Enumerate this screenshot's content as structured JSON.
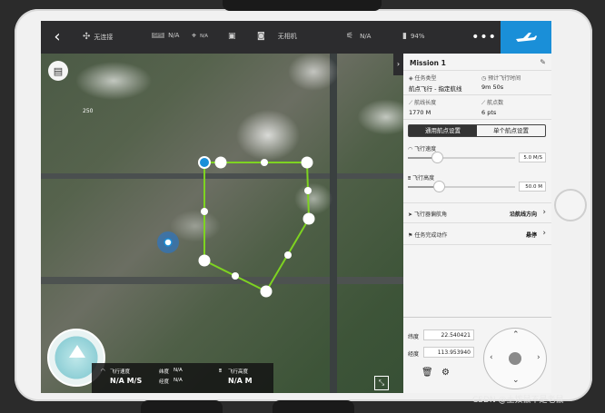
{
  "topbar": {
    "connection": "无连接",
    "gps": "N/A",
    "signal": "N/A",
    "camera": "无相机",
    "mode_value": "N/A",
    "battery": "94%",
    "more_label": "•••"
  },
  "map": {
    "scale_label": "250"
  },
  "panel": {
    "title": "Mission 1",
    "task_type_label": "任务类型",
    "task_type_value": "航点飞行 - 指定航线",
    "est_time_label": "预计飞行时间",
    "est_time_value": "9m 50s",
    "route_length_label": "航线长度",
    "route_length_value": "1770 M",
    "waypoint_count_label": "航点数",
    "waypoint_count_value": "6 pts",
    "tab_general": "通用航点设置",
    "tab_single": "单个航点设置",
    "speed_label": "飞行速度",
    "speed_value": "5.0 M/S",
    "speed_fraction": 0.27,
    "altitude_label": "飞行高度",
    "altitude_value": "50.0 M",
    "altitude_fraction": 0.29,
    "heading_label": "飞行器偏航角",
    "heading_value": "沿航线方向",
    "finish_label": "任务完成动作",
    "finish_value": "悬停",
    "lat_label": "纬度",
    "lat_value": "22.540421",
    "lng_label": "经度",
    "lng_value": "113.953940"
  },
  "telemetry": {
    "speed_label": "飞行速度",
    "speed_value": "N/A M/S",
    "lat_label": "纬度",
    "lat_value": "N/A",
    "lng_label": "经度",
    "lng_value": "N/A",
    "alt_label": "飞行高度",
    "alt_value": "N/A M"
  },
  "watermark": "CSDN @土拨鼠不是老鼠",
  "colors": {
    "accent": "#1a8fd8",
    "route": "#7ed321",
    "topbar": "#2c2c2e"
  }
}
